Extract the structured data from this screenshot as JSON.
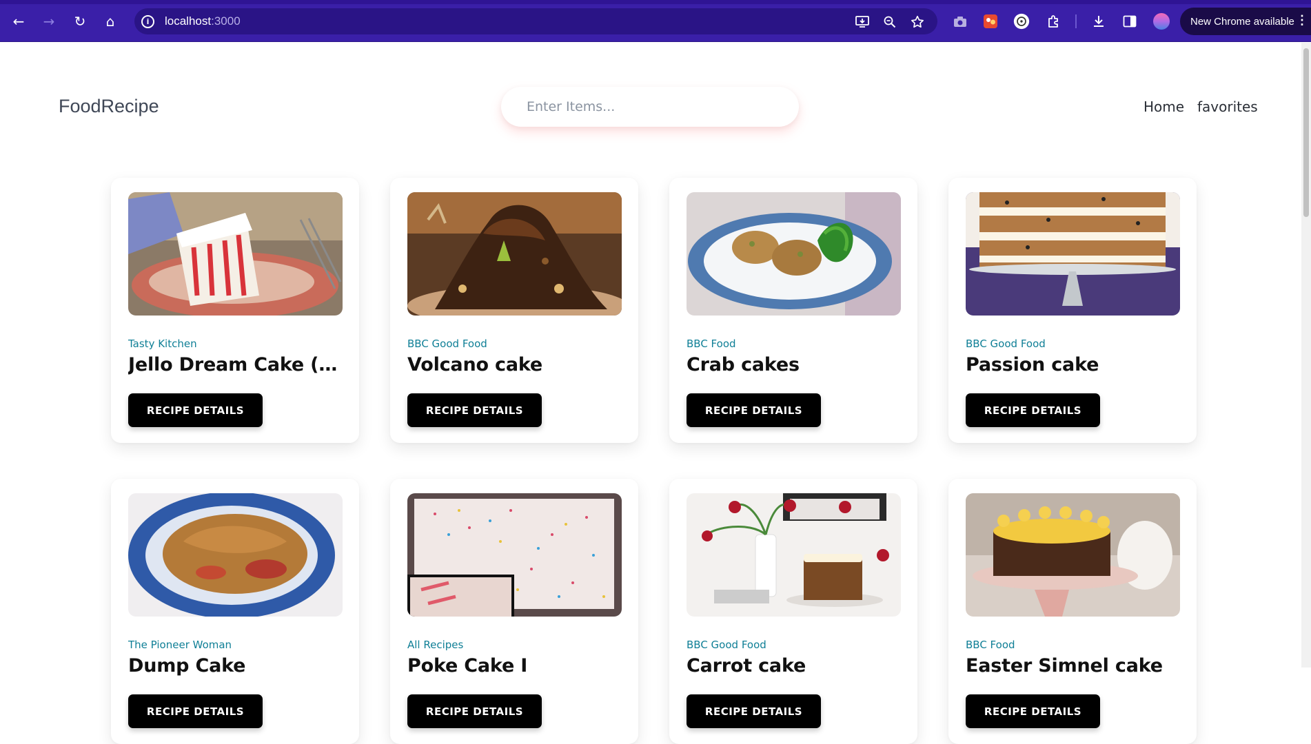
{
  "browser": {
    "back_icon": "←",
    "forward_icon": "→",
    "reload_icon": "↻",
    "home_icon": "⌂",
    "info_icon": "i",
    "url_host": "localhost",
    "url_port": ":3000",
    "update_label": "New Chrome available",
    "menu_icon": "⋮"
  },
  "app": {
    "brand": "FoodRecipe",
    "search_placeholder": "Enter Items...",
    "nav": {
      "home": "Home",
      "favorites": "favorites"
    }
  },
  "recipes": [
    {
      "publisher": "Tasty Kitchen",
      "title": "Jello Dream Cake (Pok...",
      "button": "RECIPE DETAILS"
    },
    {
      "publisher": "BBC Good Food",
      "title": "Volcano cake",
      "button": "RECIPE DETAILS"
    },
    {
      "publisher": "BBC Food",
      "title": "Crab cakes",
      "button": "RECIPE DETAILS"
    },
    {
      "publisher": "BBC Good Food",
      "title": "Passion cake",
      "button": "RECIPE DETAILS"
    },
    {
      "publisher": "The Pioneer Woman",
      "title": "Dump Cake",
      "button": "RECIPE DETAILS"
    },
    {
      "publisher": "All Recipes",
      "title": "Poke Cake I",
      "button": "RECIPE DETAILS"
    },
    {
      "publisher": "BBC Good Food",
      "title": "Carrot cake",
      "button": "RECIPE DETAILS"
    },
    {
      "publisher": "BBC Food",
      "title": "Easter Simnel cake",
      "button": "RECIPE DETAILS"
    }
  ],
  "colors": {
    "chrome": "#3a1fa8",
    "publisher": "#0f7f96",
    "button": "#000000"
  }
}
